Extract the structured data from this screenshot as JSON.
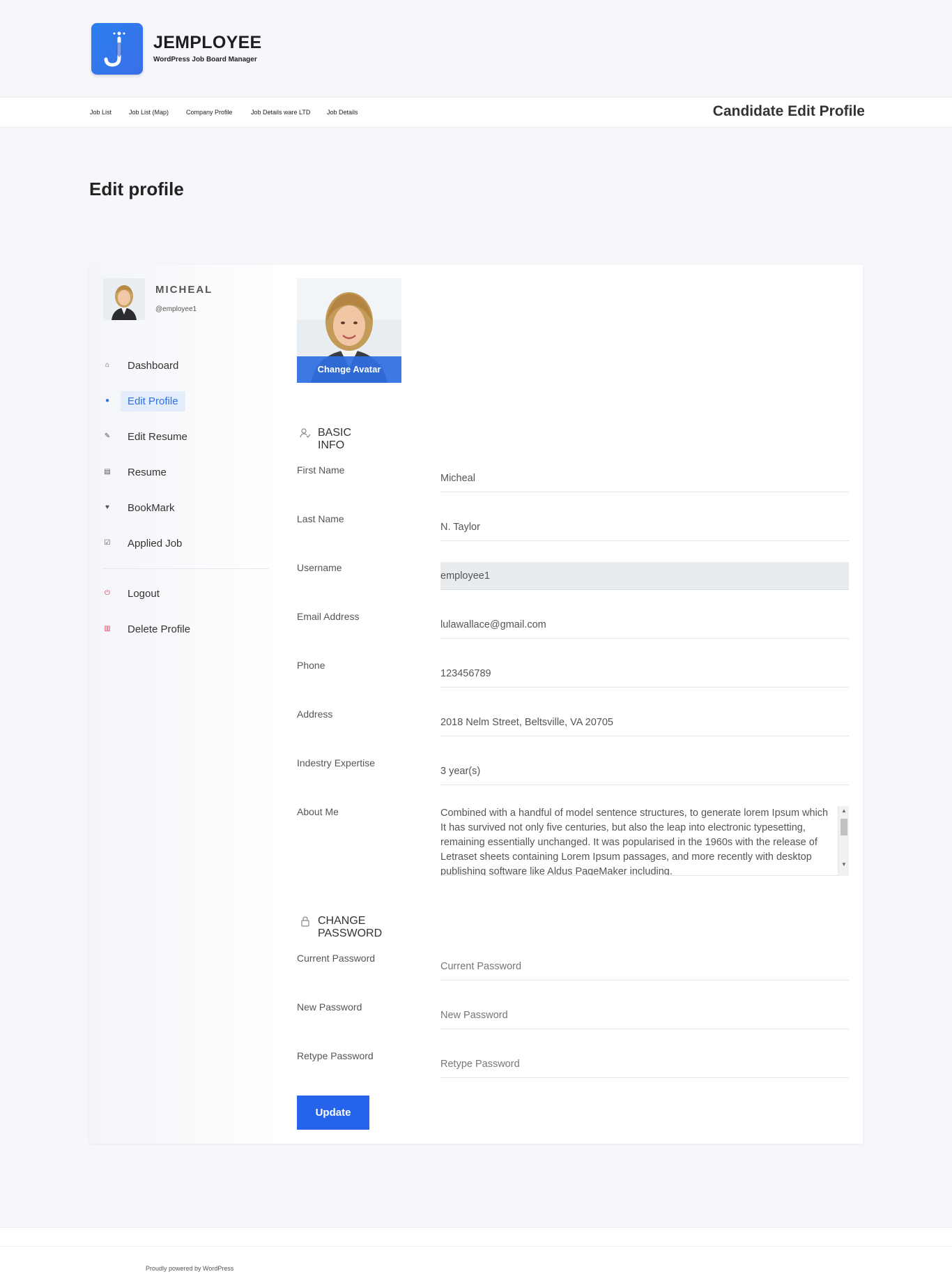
{
  "brand": {
    "name": "JEMPLOYEE",
    "tagline": "WordPress Job Board Manager"
  },
  "nav": {
    "links": [
      "Job List",
      "Job List (Map)",
      "Company Profile",
      "Job Details ware LTD",
      "Job Details"
    ],
    "page_heading": "Candidate Edit Profile"
  },
  "page": {
    "title": "Edit profile"
  },
  "profile": {
    "name": "MICHEAL",
    "handle": "@employee1"
  },
  "sidebar": {
    "items": [
      {
        "label": "Dashboard",
        "icon": "home-icon"
      },
      {
        "label": "Edit Profile",
        "icon": "user-icon"
      },
      {
        "label": "Edit Resume",
        "icon": "edit-icon"
      },
      {
        "label": "Resume",
        "icon": "file-icon"
      },
      {
        "label": "BookMark",
        "icon": "heart-icon"
      },
      {
        "label": "Applied Job",
        "icon": "check-square-icon"
      }
    ],
    "bottom_items": [
      {
        "label": "Logout",
        "icon": "power-icon"
      },
      {
        "label": "Delete Profile",
        "icon": "trash-icon"
      }
    ],
    "accent": "#2f6fe3",
    "danger": "#e43d5a"
  },
  "avatar": {
    "change_label": "Change Avatar"
  },
  "basic_info": {
    "heading": "BASIC INFO",
    "fields": {
      "first_name": {
        "label": "First Name",
        "value": "Micheal"
      },
      "last_name": {
        "label": "Last Name",
        "value": "N. Taylor"
      },
      "username": {
        "label": "Username",
        "value": "employee1"
      },
      "email": {
        "label": "Email Address",
        "value": "lulawallace@gmail.com"
      },
      "phone": {
        "label": "Phone",
        "value": "123456789"
      },
      "address": {
        "label": "Address",
        "value": "2018 Nelm Street, Beltsville, VA 20705"
      },
      "expertise": {
        "label": "Indestry Expertise",
        "value": "3 year(s)"
      },
      "about": {
        "label": "About Me",
        "value": "Combined with a handful of model sentence structures, to generate lorem Ipsum which It has survived not only five centuries, but also the leap into electronic typesetting, remaining essentially unchanged. It was popularised in the 1960s with the release of Letraset sheets containing Lorem Ipsum passages, and more recently with desktop publishing software like Aldus PageMaker including."
      }
    }
  },
  "password": {
    "heading": "CHANGE PASSWORD",
    "fields": {
      "current": {
        "label": "Current Password",
        "placeholder": "Current Password"
      },
      "new": {
        "label": "New Password",
        "placeholder": "New Password"
      },
      "retype": {
        "label": "Retype Password",
        "placeholder": "Retype Password"
      }
    }
  },
  "actions": {
    "update_label": "Update",
    "update_color": "#2563eb"
  },
  "footer": {
    "text": "Proudly powered by WordPress"
  }
}
